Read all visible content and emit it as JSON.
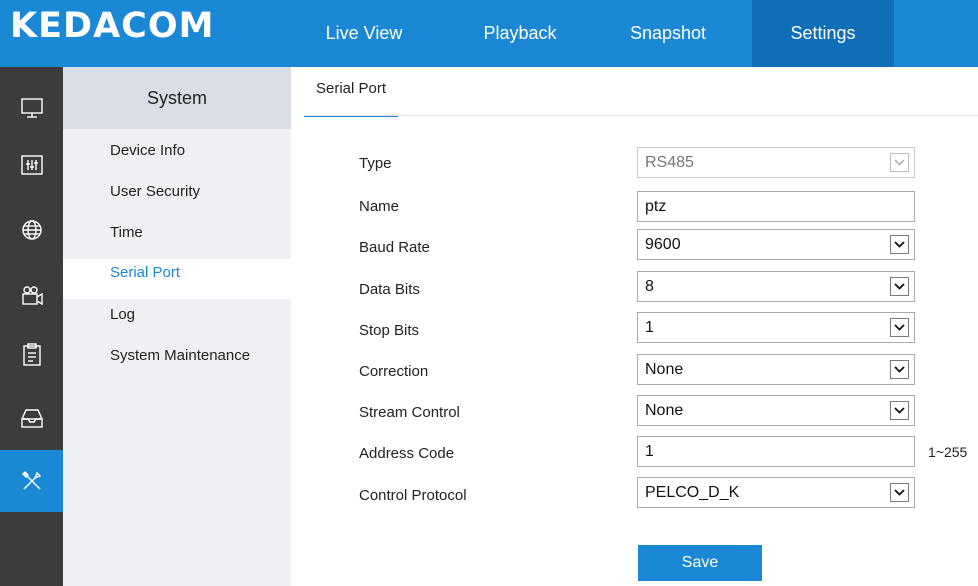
{
  "brand": {
    "logo": "KEDACOM"
  },
  "nav": {
    "items": [
      {
        "label": "Live View"
      },
      {
        "label": "Playback"
      },
      {
        "label": "Snapshot"
      },
      {
        "label": "Settings",
        "active": true
      }
    ]
  },
  "sidebar_icons": [
    {
      "icon": "monitor-icon"
    },
    {
      "icon": "sliders-icon"
    },
    {
      "icon": "globe-icon"
    },
    {
      "icon": "camera-icon"
    },
    {
      "icon": "clipboard-icon"
    },
    {
      "icon": "storage-icon"
    },
    {
      "icon": "tools-icon",
      "active": true
    }
  ],
  "menu": {
    "header": "System",
    "items": [
      {
        "label": "Device Info"
      },
      {
        "label": "User Security"
      },
      {
        "label": "Time"
      },
      {
        "label": "Serial Port",
        "active": true
      },
      {
        "label": "Log"
      },
      {
        "label": "System Maintenance"
      }
    ]
  },
  "tab": {
    "label": "Serial Port"
  },
  "form": {
    "type": {
      "label": "Type",
      "value": "RS485",
      "disabled": true
    },
    "name": {
      "label": "Name",
      "value": "ptz"
    },
    "baud_rate": {
      "label": "Baud Rate",
      "value": "9600"
    },
    "data_bits": {
      "label": "Data Bits",
      "value": "8"
    },
    "stop_bits": {
      "label": "Stop Bits",
      "value": "1"
    },
    "correction": {
      "label": "Correction",
      "value": "None"
    },
    "stream_control": {
      "label": "Stream Control",
      "value": "None"
    },
    "address_code": {
      "label": "Address Code",
      "value": "1",
      "range": "1~255"
    },
    "control_protocol": {
      "label": "Control Protocol",
      "value": "PELCO_D_K"
    }
  },
  "actions": {
    "save_label": "Save"
  },
  "colors": {
    "accent": "#1b88d6",
    "accent_dark": "#0e6fb8",
    "sidebar_bg": "#3c3c3c",
    "menu_bg": "#eef0f4"
  }
}
